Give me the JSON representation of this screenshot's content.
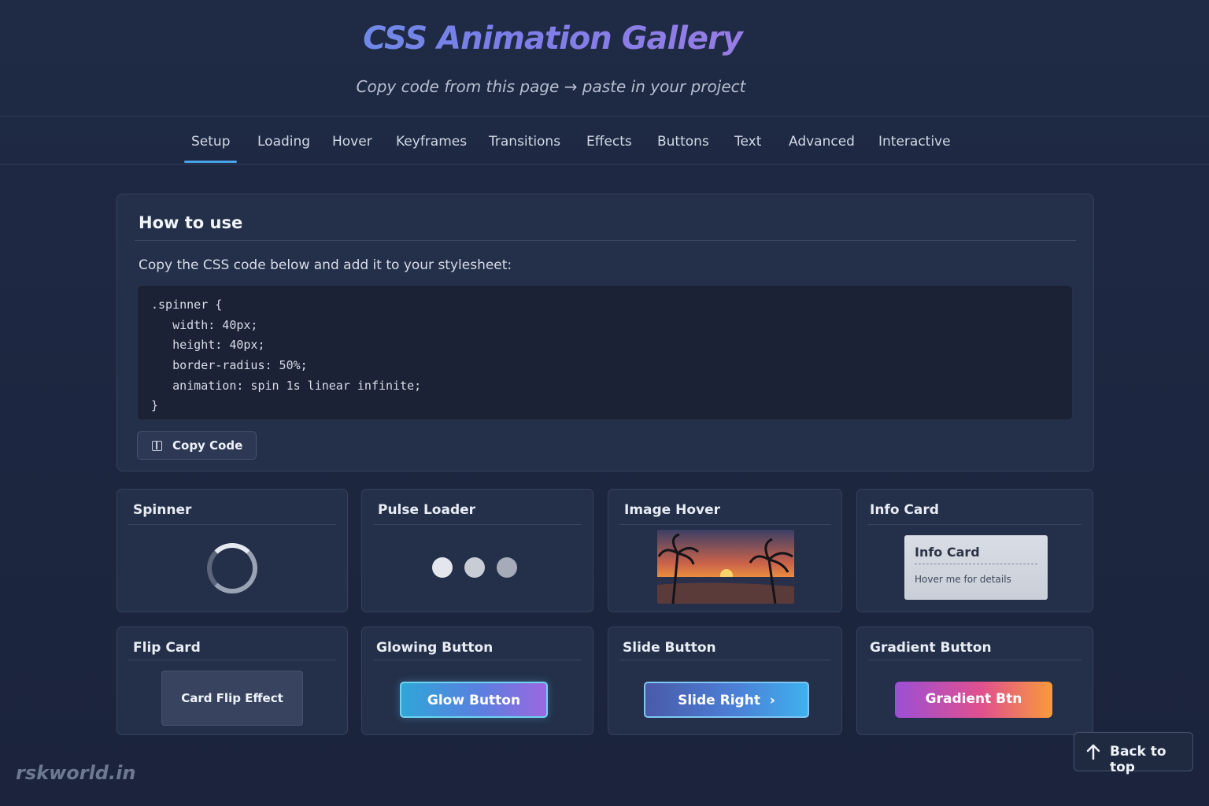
{
  "header": {
    "title": "CSS Animation Gallery",
    "subtitle": "Copy code from this page → paste in your project"
  },
  "nav": {
    "tabs": [
      {
        "label": "Setup",
        "active": true
      },
      {
        "label": "Loading"
      },
      {
        "label": "Hover"
      },
      {
        "label": "Keyframes"
      },
      {
        "label": "Transitions"
      },
      {
        "label": "Effects"
      },
      {
        "label": "Buttons"
      },
      {
        "label": "Text"
      },
      {
        "label": "Advanced"
      },
      {
        "label": "Interactive"
      }
    ]
  },
  "how_to": {
    "title": "How to use",
    "description": "Copy the CSS code below and add it to your stylesheet:",
    "code_lines": [
      ".spinner {",
      "   width: 40px;",
      "   height: 40px;",
      "   border-radius: 50%;",
      "   animation: spin 1s linear infinite;",
      "}"
    ],
    "copy_button": "Copy Code"
  },
  "cards": {
    "spinner": {
      "title": "Spinner"
    },
    "pulse": {
      "title": "Pulse Loader"
    },
    "image_hover": {
      "title": "Image Hover"
    },
    "info_card": {
      "title": "Info Card",
      "inner_title": "Info Card",
      "inner_text": "Hover me for details"
    },
    "flip_card": {
      "title": "Flip Card",
      "inner_text": "Card Flip Effect"
    },
    "glowing": {
      "title": "Glowing Button",
      "button": "Glow Button"
    },
    "slide": {
      "title": "Slide Button",
      "button": "Slide Right"
    },
    "gradient": {
      "title": "Gradient Button",
      "button": "Gradient Btn"
    }
  },
  "footer": {
    "watermark": "rskworld.in",
    "back_to_top": "Back to top"
  },
  "colors": {
    "accent": "#4aa3e8",
    "background": "#1f2a44",
    "panel": "#243049"
  }
}
